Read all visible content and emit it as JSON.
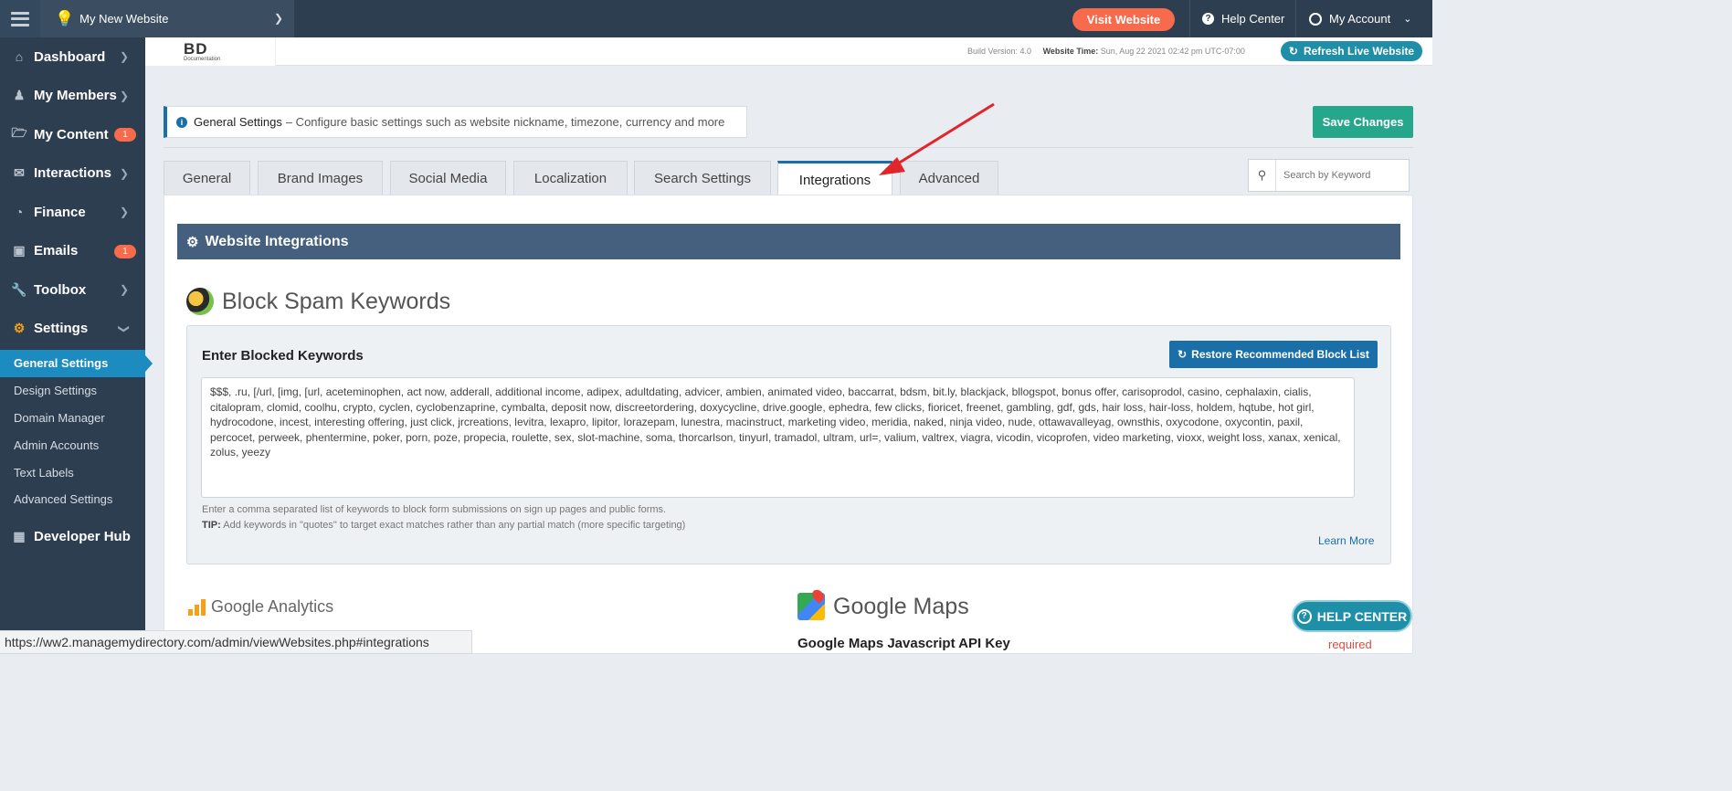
{
  "topbar": {
    "site_name": "My New Website",
    "visit_label": "Visit Website",
    "help_label": "Help Center",
    "account_label": "My Account"
  },
  "sidebar": {
    "items": [
      {
        "label": "Dashboard",
        "icon": "home-icon"
      },
      {
        "label": "My Members",
        "icon": "users-icon"
      },
      {
        "label": "My Content",
        "icon": "folder-icon",
        "badge": "1"
      },
      {
        "label": "Interactions",
        "icon": "comments-icon"
      },
      {
        "label": "Finance",
        "icon": "pie-chart-icon"
      },
      {
        "label": "Emails",
        "icon": "inbox-icon",
        "badge": "1"
      },
      {
        "label": "Toolbox",
        "icon": "wrench-icon"
      },
      {
        "label": "Settings",
        "icon": "gear-icon"
      }
    ],
    "sub_items": [
      "General Settings",
      "Design Settings",
      "Domain Manager",
      "Admin Accounts",
      "Text Labels",
      "Advanced Settings"
    ],
    "dev_hub": "Developer Hub"
  },
  "header": {
    "logo_text": "BD",
    "logo_sub": "Documentation",
    "build_label": "Build Version: 4.0",
    "time_label": "Website Time:",
    "time_value": "Sun, Aug 22 2021 02:42 pm UTC-07:00",
    "refresh_label": "Refresh Live Website"
  },
  "banner": {
    "title": "General Settings",
    "text": "– Configure basic settings such as website nickname, timezone, currency and more",
    "save_label": "Save Changes"
  },
  "tabs": [
    "General",
    "Brand Images",
    "Social Media",
    "Localization",
    "Search Settings",
    "Integrations",
    "Advanced"
  ],
  "search": {
    "placeholder": "Search by Keyword"
  },
  "main": {
    "section_title": "Website Integrations",
    "spam_title": "Block Spam Keywords",
    "spam_label": "Enter Blocked Keywords",
    "restore_label": "Restore Recommended Block List",
    "keywords": "$$$, .ru, [/url, [img, [url, aceteminophen, act now, adderall, additional income, adipex, adultdating, advicer, ambien, animated video, baccarrat, bdsm, bit.ly, blackjack, bllogspot, bonus offer, carisoprodol, casino, cephalaxin, cialis, citalopram, clomid, coolhu, crypto, cyclen, cyclobenzaprine, cymbalta, deposit now, discreetordering, doxycycline, drive.google, ephedra, few clicks, fioricet, freenet, gambling, gdf, gds, hair loss, hair-loss, holdem, hqtube, hot girl, hydrocodone, incest, interesting offering, just click, jrcreations, levitra, lexapro, lipitor, lorazepam, lunestra, macinstruct, marketing video, meridia, naked, ninja video, nude, ottawavalleyag, ownsthis, oxycodone, oxycontin, paxil, percocet, perweek, phentermine, poker, porn, poze, propecia, roulette, sex, slot-machine, soma, thorcarlson, tinyurl, tramadol, ultram, url=, valium, valtrex, viagra, vicodin, vicoprofen, video marketing, vioxx, weight loss, xanax, xenical, zolus, yeezy",
    "hint1": "Enter a comma separated list of keywords to block form submissions on sign up pages and public forms.",
    "hint2_tip": "TIP:",
    "hint2": "Add keywords in \"quotes\" to target exact matches rather than any partial match (more specific targeting)",
    "learn_more": "Learn More",
    "ga_title": "Google Analytics",
    "gm_title": "Google Maps",
    "gm_key_label": "Google Maps Javascript API Key",
    "required": "required"
  },
  "help_float": "HELP CENTER",
  "status_url": "https://ww2.managemydirectory.com/admin/viewWebsites.php#integrations",
  "colors": {
    "sidebar": "#2d3e50",
    "accent": "#1b6fa8",
    "visit": "#f86a4c",
    "save": "#26a78b",
    "annotation_arrow": "#e0262a"
  }
}
